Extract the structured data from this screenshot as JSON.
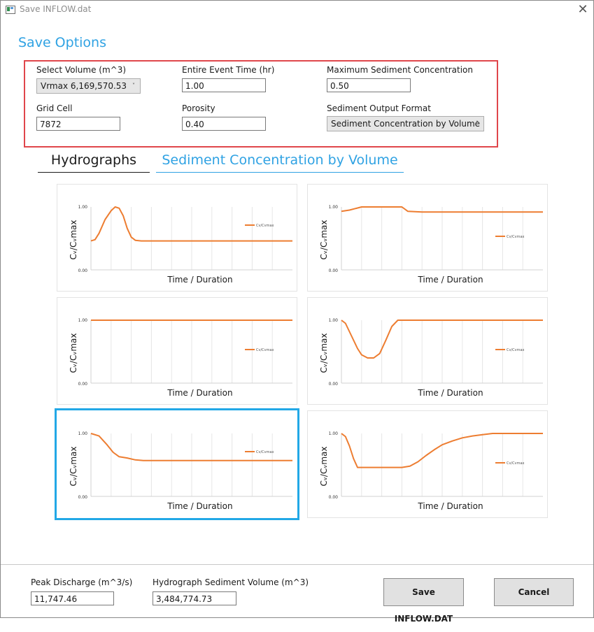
{
  "window": {
    "title": "Save INFLOW.dat",
    "close_glyph": "✕"
  },
  "section_title": "Save Options",
  "options": {
    "select_volume": {
      "label": "Select Volume (m^3)",
      "value": "Vrmax 6,169,570.53"
    },
    "entire_event_time": {
      "label": "Entire Event Time (hr)",
      "value": "1.00"
    },
    "max_sediment_concentration": {
      "label": "Maximum Sediment Concentration",
      "value": "0.50"
    },
    "grid_cell": {
      "label": "Grid Cell",
      "value": "7872"
    },
    "porosity": {
      "label": "Porosity",
      "value": "0.40"
    },
    "sediment_output_format": {
      "label": "Sediment Output Format",
      "value": "Sediment Concentration by Volume"
    }
  },
  "tabs": [
    {
      "label": "Hydrographs",
      "active": false
    },
    {
      "label": "Sediment Concentration by Volume",
      "active": true
    }
  ],
  "chart_data": [
    {
      "type": "line",
      "ylabel": "Cᵥ/Cᵥmax",
      "xlabel": "Time / Duration",
      "yticks": [
        "0.00",
        "1.00"
      ],
      "legend": "Cv/Cvmax",
      "color": "#ed7d31",
      "selected": false,
      "x": [
        0,
        0.02,
        0.04,
        0.07,
        0.1,
        0.12,
        0.14,
        0.16,
        0.18,
        0.2,
        0.22,
        0.25,
        0.3,
        1
      ],
      "y": [
        0.46,
        0.48,
        0.58,
        0.8,
        0.94,
        1.0,
        0.98,
        0.86,
        0.66,
        0.52,
        0.47,
        0.46,
        0.46,
        0.46
      ]
    },
    {
      "type": "line",
      "ylabel": "Cᵥ/Cᵥmax",
      "xlabel": "Time / Duration",
      "yticks": [
        "0.00",
        "1.00"
      ],
      "legend": "Cv/Cvmax",
      "color": "#ed7d31",
      "selected": false,
      "x": [
        0,
        0.04,
        0.1,
        0.2,
        0.3,
        0.33,
        0.4,
        1
      ],
      "y": [
        0.93,
        0.95,
        1.0,
        1.0,
        1.0,
        0.93,
        0.92,
        0.92
      ]
    },
    {
      "type": "line",
      "ylabel": "Cᵥ/Cᵥmax",
      "xlabel": "Time / Duration",
      "yticks": [
        "0.00",
        "1.00"
      ],
      "legend": "Cv/Cvmax",
      "color": "#ed7d31",
      "selected": false,
      "x": [
        0,
        1
      ],
      "y": [
        1.0,
        1.0
      ]
    },
    {
      "type": "line",
      "ylabel": "Cᵥ/Cᵥmax",
      "xlabel": "Time / Duration",
      "yticks": [
        "0.00",
        "1.00"
      ],
      "legend": "Cv/Cvmax",
      "color": "#ed7d31",
      "selected": false,
      "x": [
        0,
        0.02,
        0.05,
        0.08,
        0.1,
        0.13,
        0.16,
        0.19,
        0.22,
        0.25,
        0.28,
        1
      ],
      "y": [
        1.0,
        0.95,
        0.75,
        0.55,
        0.45,
        0.4,
        0.4,
        0.47,
        0.68,
        0.9,
        1.0,
        1.0
      ]
    },
    {
      "type": "line",
      "ylabel": "Cᵥ/Cᵥmax",
      "xlabel": "Time / Duration",
      "yticks": [
        "0.00",
        "1.00"
      ],
      "legend": "Cv/Cvmax",
      "color": "#ed7d31",
      "selected": true,
      "x": [
        0,
        0.04,
        0.08,
        0.11,
        0.14,
        0.18,
        0.22,
        0.26,
        0.3,
        1
      ],
      "y": [
        1.0,
        0.96,
        0.82,
        0.7,
        0.63,
        0.61,
        0.58,
        0.57,
        0.57,
        0.57
      ]
    },
    {
      "type": "line",
      "ylabel": "Cᵥ/Cᵥmax",
      "xlabel": "Time / Duration",
      "yticks": [
        "0.00",
        "1.00"
      ],
      "legend": "Cv/Cvmax",
      "color": "#ed7d31",
      "selected": false,
      "x": [
        0,
        0.02,
        0.04,
        0.06,
        0.08,
        0.3,
        0.34,
        0.38,
        0.42,
        0.46,
        0.5,
        0.55,
        0.6,
        0.65,
        0.7,
        0.75,
        1
      ],
      "y": [
        1.0,
        0.95,
        0.8,
        0.6,
        0.46,
        0.46,
        0.48,
        0.55,
        0.65,
        0.74,
        0.82,
        0.88,
        0.93,
        0.96,
        0.98,
        1.0,
        1.0
      ]
    }
  ],
  "footer": {
    "peak_discharge": {
      "label": "Peak Discharge (m^3/s)",
      "value": "11,747.46"
    },
    "hydrograph_sediment_volume": {
      "label": "Hydrograph Sediment Volume (m^3)",
      "value": "3,484,774.73"
    },
    "save_button": "Save INFLOW.DAT",
    "cancel_button": "Cancel"
  }
}
